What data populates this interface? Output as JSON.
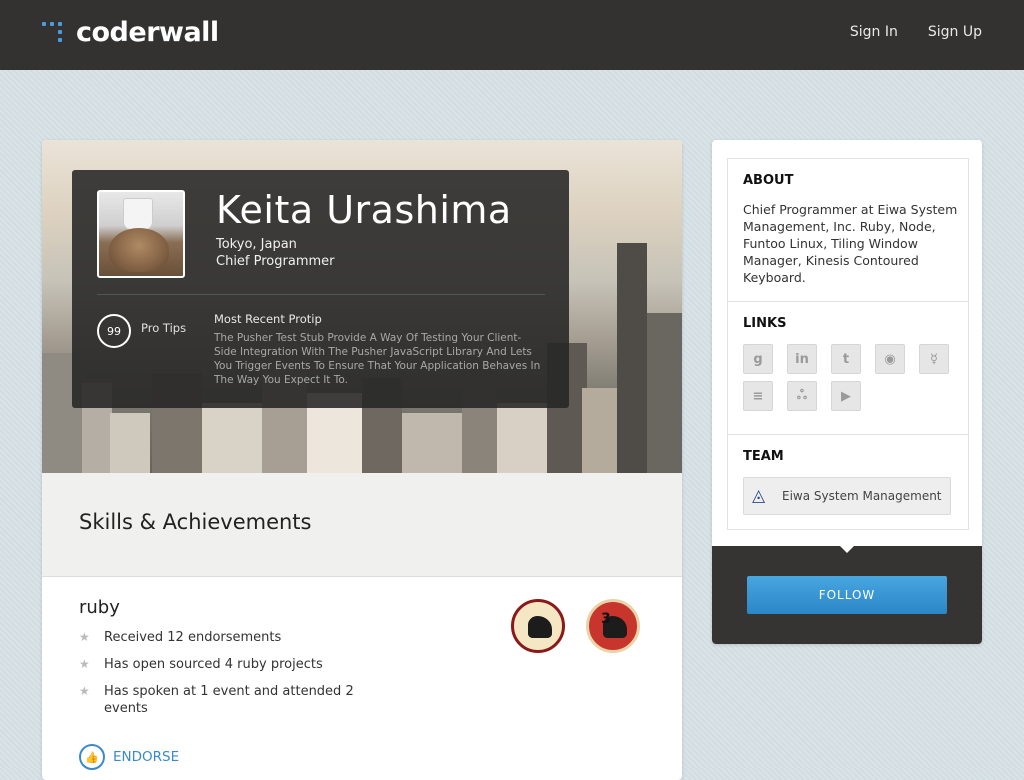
{
  "header": {
    "logo_text": "coderwall",
    "nav": {
      "sign_in": "Sign In",
      "sign_up": "Sign Up"
    },
    "accent_color": "#4a9de0"
  },
  "profile": {
    "name": "Keita Urashima",
    "location": "Tokyo, Japan",
    "title": "Chief Programmer",
    "protips": {
      "count": "99",
      "label": "Pro Tips"
    },
    "recent_protip": {
      "heading": "Most Recent Protip",
      "text": "The Pusher Test Stub Provide A Way Of Testing Your Client-Side Integration With The Pusher JavaScript Library And Lets You Trigger Events To Ensure That Your Application Behaves In The Way You Expect It To."
    }
  },
  "skills": {
    "heading": "Skills & Achievements",
    "items": [
      {
        "name": "ruby",
        "achievements": [
          "Received 12 endorsements",
          "Has open sourced 4 ruby projects",
          "Has spoken at 1 event and attended 2 events"
        ],
        "badges": [
          {
            "icon": "badge-beast-icon",
            "number": ""
          },
          {
            "icon": "badge-beast-3-icon",
            "number": "3"
          }
        ],
        "endorse_label": "ENDORSE"
      }
    ]
  },
  "sidebar": {
    "about": {
      "title": "ABOUT",
      "text": "Chief Programmer at Eiwa System Management, Inc. Ruby, Node, Funtoo Linux, Tiling Window Manager, Kinesis Contoured Keyboard."
    },
    "links": {
      "title": "LINKS",
      "icons": [
        "github-icon",
        "linkedin-icon",
        "twitter-icon",
        "rss-icon",
        "speakerdeck-icon",
        "stackoverflow-icon",
        "slideshare-icon",
        "youtube-icon"
      ]
    },
    "team": {
      "title": "TEAM",
      "name": "Eiwa System Management"
    },
    "follow_label": "FOLLOW"
  }
}
